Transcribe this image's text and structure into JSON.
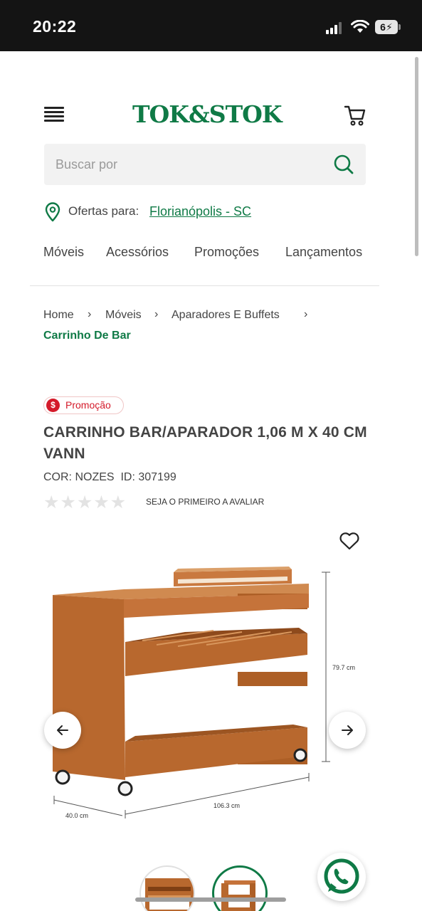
{
  "status_bar": {
    "time": "20:22",
    "battery": "6"
  },
  "header": {
    "logo": "TOK&STOK"
  },
  "search": {
    "placeholder": "Buscar por"
  },
  "location": {
    "label": "Ofertas para:",
    "city": "Florianópolis - SC"
  },
  "categories": [
    "Móveis",
    "Acessórios",
    "Promoções",
    "Lançamentos"
  ],
  "breadcrumb": {
    "items": [
      "Home",
      "Móveis",
      "Aparadores E Buffets"
    ],
    "current": "Carrinho De Bar"
  },
  "product": {
    "badge": "Promoção",
    "badge_symbol": "$",
    "title": "CARRINHO BAR/APARADOR 1,06 M X 40 CM VANN",
    "meta": "COR: NOZES  ID: 307199",
    "rating_stars": 0,
    "review_cta": "SEJA O PRIMEIRO A AVALIAR",
    "dimensions": {
      "height": "79.7 cm",
      "width": "106.3 cm",
      "depth": "40.0 cm"
    }
  },
  "colors": {
    "brand": "#0f7a46",
    "promo": "#d41a2a",
    "wood": "#b8682e"
  }
}
